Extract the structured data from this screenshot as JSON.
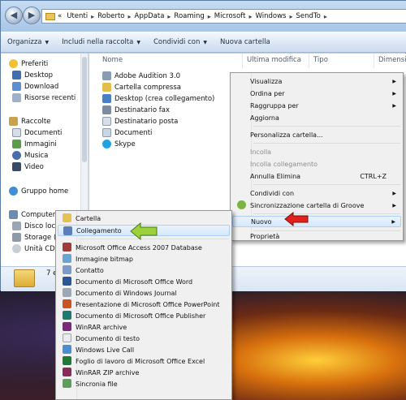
{
  "address": {
    "crumbs": [
      "«",
      "Utenti",
      "Roberto",
      "AppData",
      "Roaming",
      "Microsoft",
      "Windows",
      "SendTo"
    ]
  },
  "toolbar": {
    "organize": "Organizza",
    "include": "Includi nella raccolta",
    "share": "Condividi con",
    "new_folder": "Nuova cartella"
  },
  "nav": {
    "favorites": "Preferiti",
    "desktop": "Desktop",
    "downloads": "Download",
    "recent": "Risorse recenti",
    "libraries": "Raccolte",
    "documents": "Documenti",
    "images": "Immagini",
    "music": "Musica",
    "video": "Video",
    "homegroup": "Gruppo home",
    "computer": "Computer",
    "disk": "Disco loc",
    "storage": "Storage (",
    "drive_cd": "Unità CD"
  },
  "columns": {
    "name": "Nome",
    "modified": "Ultima modifica",
    "type": "Tipo",
    "size": "Dimensio"
  },
  "files": [
    {
      "name": "Adobe Audition 3.0",
      "icon": "audition-folder-icon",
      "color": "#8a9cb3"
    },
    {
      "name": "Cartella compressa",
      "icon": "zip-folder-icon",
      "color": "#e2be4c"
    },
    {
      "name": "Desktop (crea collegamento)",
      "icon": "desktop-shortcut-icon",
      "color": "#4a7fc1"
    },
    {
      "name": "Destinatario fax",
      "icon": "fax-icon",
      "color": "#7d8c9c"
    },
    {
      "name": "Destinatario posta",
      "icon": "mail-icon",
      "color": "#d9dfe6"
    },
    {
      "name": "Documenti",
      "icon": "documents-icon",
      "color": "#c9d6e6"
    },
    {
      "name": "Skype",
      "icon": "skype-icon",
      "color": "#1fa3e3"
    }
  ],
  "status": {
    "count": "7 e"
  },
  "context_menu": {
    "view": "Visualizza",
    "sort": "Ordina per",
    "group": "Raggruppa per",
    "refresh": "Aggiorna",
    "customize": "Personalizza cartella...",
    "paste": "Incolla",
    "paste_link": "Incolla collegamento",
    "undo": "Annulla Elimina",
    "undo_shortcut": "CTRL+Z",
    "share": "Condividi con",
    "groove": "Sincronizzazione cartella di Groove",
    "new": "Nuovo",
    "properties": "Proprietà"
  },
  "new_menu": [
    {
      "label": "Cartella",
      "icon": "folder-icon",
      "color": "#e6c251"
    },
    {
      "label": "Collegamento",
      "icon": "shortcut-icon",
      "color": "#5d7fb8"
    },
    {
      "label": "Microsoft Office Access 2007 Database",
      "icon": "access-icon",
      "color": "#a33a3a"
    },
    {
      "label": "Immagine bitmap",
      "icon": "bitmap-icon",
      "color": "#6aa3d6"
    },
    {
      "label": "Contatto",
      "icon": "contact-icon",
      "color": "#7b9cc8"
    },
    {
      "label": "Documento di Microsoft Office Word",
      "icon": "word-icon",
      "color": "#2b5797"
    },
    {
      "label": "Documento di Windows Journal",
      "icon": "journal-icon",
      "color": "#9aa8b8"
    },
    {
      "label": "Presentazione di Microsoft Office PowerPoint",
      "icon": "powerpoint-icon",
      "color": "#c9541f"
    },
    {
      "label": "Documento di Microsoft Office Publisher",
      "icon": "publisher-icon",
      "color": "#1e7a6e"
    },
    {
      "label": "WinRAR archive",
      "icon": "winrar-icon",
      "color": "#7a2a7a"
    },
    {
      "label": "Documento di testo",
      "icon": "text-document-icon",
      "color": "#e8ecf0"
    },
    {
      "label": "Windows Live Call",
      "icon": "live-call-icon",
      "color": "#4a8ed0"
    },
    {
      "label": "Foglio di lavoro di Microsoft Office Excel",
      "icon": "excel-icon",
      "color": "#1f7a3a"
    },
    {
      "label": "WinRAR ZIP archive",
      "icon": "winrar-zip-icon",
      "color": "#8a2a5a"
    },
    {
      "label": "Sincronia file",
      "icon": "sync-icon",
      "color": "#5aa05a"
    }
  ]
}
